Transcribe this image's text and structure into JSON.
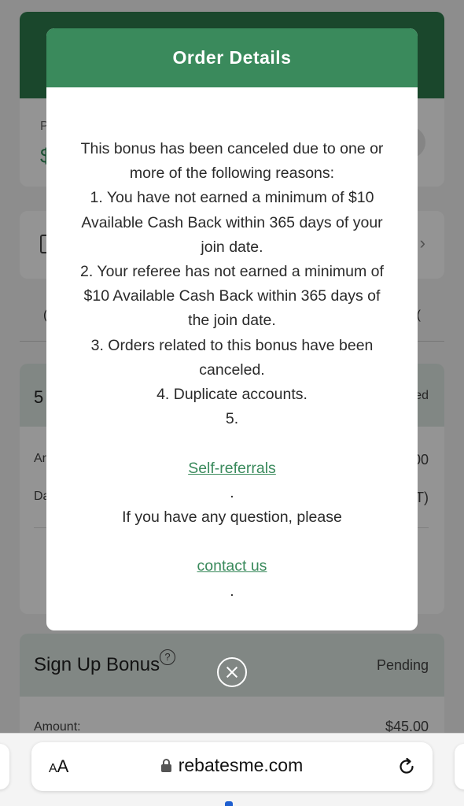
{
  "background": {
    "balance_label": "P",
    "balance_value": "$",
    "tabs": [
      "(",
      "("
    ],
    "bonus1": {
      "title": "5",
      "status": "ed",
      "amount_label": "Ar",
      "amount_value": "00",
      "date_label": "Da",
      "date_value": "T)"
    },
    "bonus2": {
      "title": "Sign Up Bonus",
      "help_symbol": "?",
      "status": "Pending",
      "amount_label": "Amount:",
      "amount_value": "$45.00"
    }
  },
  "modal": {
    "title": "Order Details",
    "lines": [
      "This bonus has been canceled due to one or",
      "more of the following reasons:",
      "1. You have not earned a minimum of $10",
      "Available Cash Back within 365 days of your",
      "join date.",
      "2. Your referee has not earned a minimum of",
      "$10 Available Cash Back within 365 days of",
      "the join date.",
      "3. Orders related to this bonus have been",
      "canceled.",
      "4. Duplicate accounts.",
      "5."
    ],
    "self_referrals_link": "Self-referrals",
    "period_1": ".",
    "question_text": "If you have any question, please",
    "contact_link": "contact us",
    "period_2": "."
  },
  "browser": {
    "aa_small": "A",
    "aa_large": "A",
    "url": "rebatesme.com"
  },
  "colors": {
    "brand_green": "#3a8a5c",
    "header_green": "#2d7a4c",
    "link_green": "#3a8a5c"
  }
}
